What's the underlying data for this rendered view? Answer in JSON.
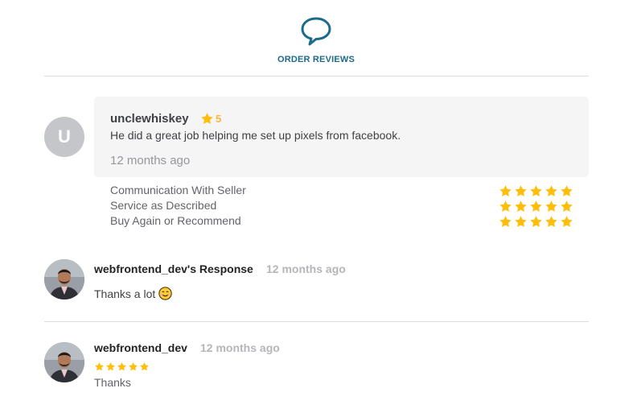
{
  "header": {
    "title": "ORDER REVIEWS",
    "icon": "chat-bubble-icon",
    "accent": "#1d6b8a"
  },
  "review": {
    "avatar_letter": "U",
    "username": "unclewhiskey",
    "rating": "5",
    "text": "He did a great job helping me set up pixels from facebook.",
    "time": "12 months ago",
    "criteria": [
      {
        "label": "Communication With Seller",
        "stars": 5
      },
      {
        "label": "Service as Described",
        "stars": 5
      },
      {
        "label": "Buy Again or Recommend",
        "stars": 5
      }
    ],
    "star_color": "#ffbe0b"
  },
  "response": {
    "title": "webfrontend_dev's Response",
    "time": "12 months ago",
    "text": "Thanks a lot"
  },
  "buyer_review": {
    "username": "webfrontend_dev",
    "time": "12 months ago",
    "stars": 5,
    "text": "Thanks"
  }
}
